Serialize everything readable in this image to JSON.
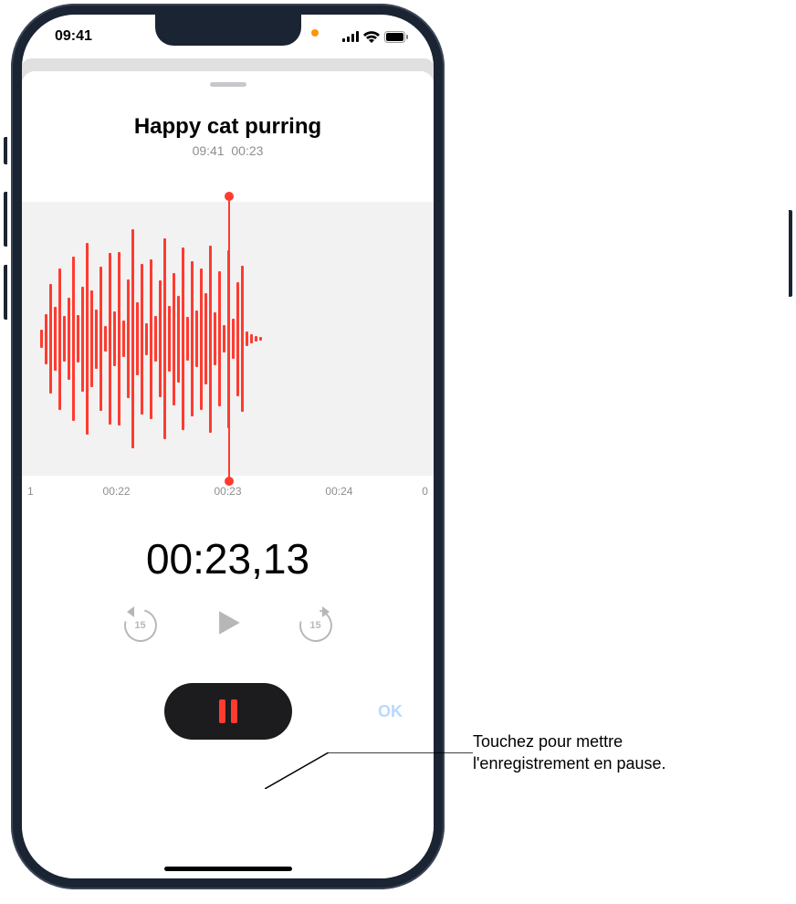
{
  "status": {
    "time": "09:41"
  },
  "recording": {
    "title": "Happy cat purring",
    "time": "09:41",
    "duration": "00:23"
  },
  "timeline": {
    "labels": [
      "1",
      "00:22",
      "00:23",
      "00:24",
      "0"
    ]
  },
  "timer": "00:23,13",
  "controls": {
    "skip_back_value": "15",
    "skip_forward_value": "15",
    "ok_label": "OK"
  },
  "callout": {
    "line1": "Touchez pour mettre",
    "line2": "l'enregistrement en pause."
  }
}
